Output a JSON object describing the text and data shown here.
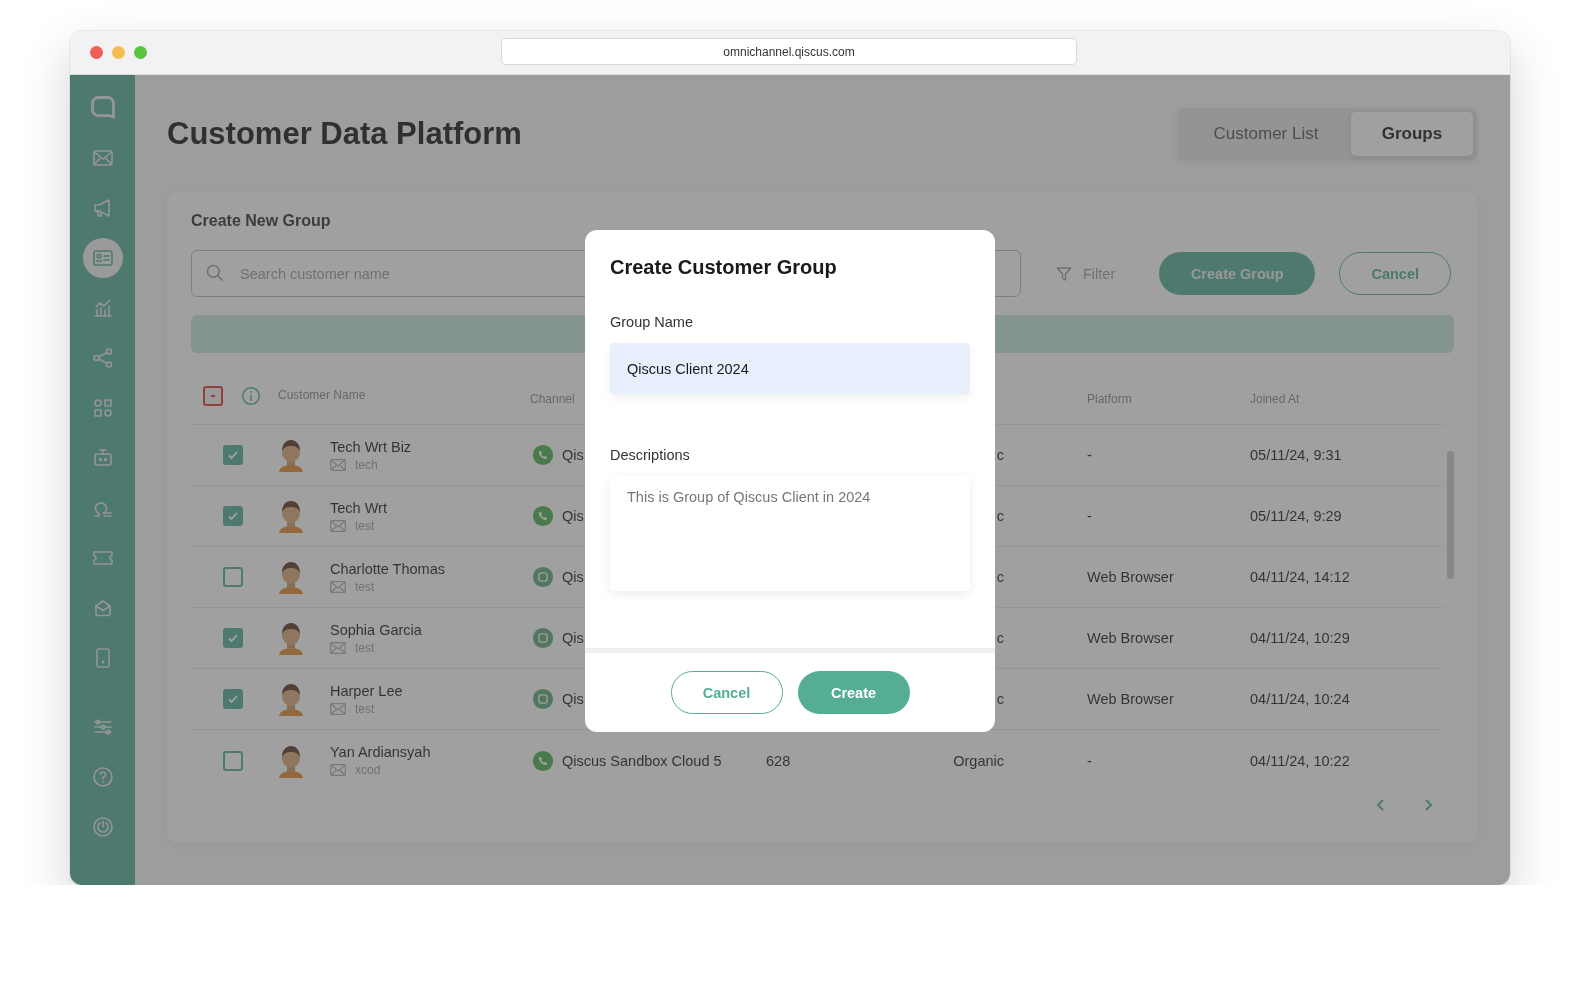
{
  "browser": {
    "url": "omnichannel.qiscus.com"
  },
  "sidebar": {
    "items": [
      {
        "selected": false
      },
      {
        "selected": false
      },
      {
        "selected": true
      },
      {
        "selected": false
      },
      {
        "selected": false
      },
      {
        "selected": false
      },
      {
        "selected": false
      },
      {
        "selected": false
      },
      {
        "selected": false
      },
      {
        "selected": false
      },
      {
        "selected": false
      }
    ],
    "bottom_items": [
      {
        "selected": false
      },
      {
        "selected": false
      },
      {
        "selected": false
      }
    ]
  },
  "page": {
    "title": "Customer Data Platform"
  },
  "view_tabs": [
    {
      "label": "Customer List",
      "selected": false
    },
    {
      "label": "Groups",
      "selected": true
    }
  ],
  "card": {
    "title": "Create New Group",
    "search": {
      "placeholder": "Search customer name"
    },
    "filter": {
      "label": "Filter"
    },
    "buttons": [
      {
        "label": "Create Group",
        "kind": "primary"
      },
      {
        "label": "Cancel",
        "kind": "outline"
      }
    ]
  },
  "table": {
    "select_all": {
      "indeterminate": true
    },
    "columns": [
      {
        "label": "Customer Name"
      },
      {
        "label": "Channel"
      },
      {
        "label": "Platform"
      },
      {
        "label": "Joined At"
      }
    ],
    "rows": [
      {
        "checked": true,
        "name": "Tech Wrt Biz",
        "handle": "tech",
        "channel": {
          "kind": "whatsapp",
          "name": "Qis"
        },
        "column_4": "c",
        "platform": "-",
        "joined_at": "05/11/24, 9:31"
      },
      {
        "checked": true,
        "name": "Tech Wrt",
        "handle": "test",
        "channel": {
          "kind": "whatsapp",
          "name": "Qis"
        },
        "column_4": "c",
        "platform": "-",
        "joined_at": "05/11/24, 9:29"
      },
      {
        "checked": false,
        "name": "Charlotte Thomas",
        "handle": "test",
        "channel": {
          "kind": "widget",
          "name": "Qis"
        },
        "column_4": "c",
        "platform": "Web Browser",
        "joined_at": "04/11/24, 14:12"
      },
      {
        "checked": true,
        "name": "Sophia Garcia",
        "handle": "test",
        "channel": {
          "kind": "widget",
          "name": "Qis"
        },
        "column_4": "c",
        "platform": "Web Browser",
        "joined_at": "04/11/24, 10:29"
      },
      {
        "checked": true,
        "name": "Harper Lee",
        "handle": "test",
        "channel": {
          "kind": "widget",
          "name": "Qis"
        },
        "column_4": "c",
        "platform": "Web Browser",
        "joined_at": "04/11/24, 10:24"
      },
      {
        "checked": false,
        "name": "Yan Ardiansyah",
        "handle": "xcod",
        "channel": {
          "kind": "whatsapp",
          "name": "Qiscus Sandbox Cloud 5"
        },
        "column_3": "628",
        "column_4": "Organic",
        "platform": "-",
        "joined_at": "04/11/24, 10:22"
      }
    ]
  },
  "modal": {
    "title": "Create Customer Group",
    "fields": [
      {
        "kind": "input",
        "label": "Group Name",
        "value": "Qiscus Client 2024"
      },
      {
        "kind": "textarea",
        "label": "Descriptions",
        "value": "This is Group of Qiscus Client in 2024"
      }
    ],
    "buttons": [
      {
        "label": "Cancel",
        "kind": "outline"
      },
      {
        "label": "Create",
        "kind": "primary"
      }
    ]
  }
}
